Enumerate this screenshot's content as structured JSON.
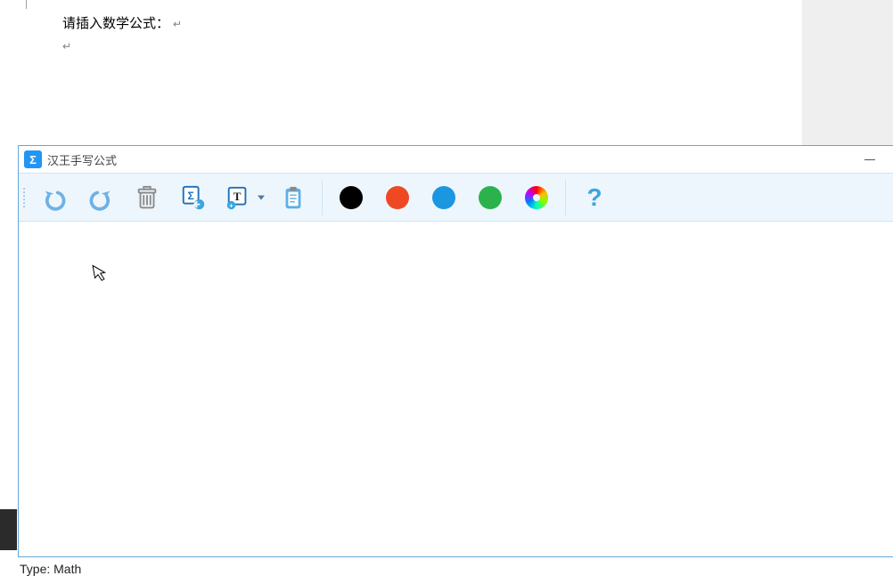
{
  "document": {
    "prompt_text": "请插入数学公式：",
    "paragraph_mark": "↵",
    "second_mark": "↵"
  },
  "status": {
    "type_label": "Type: Math"
  },
  "window": {
    "title": "汉王手写公式",
    "toolbar": {
      "undo": "undo",
      "redo": "redo",
      "delete": "delete",
      "formula_insert": "insert-formula",
      "text_insert": "insert-text",
      "clipboard": "clipboard",
      "colors": {
        "black": "#000000",
        "red": "#ef4923",
        "blue": "#1b97df",
        "green": "#2bb24c",
        "wheel": "custom"
      },
      "help": "?"
    }
  }
}
